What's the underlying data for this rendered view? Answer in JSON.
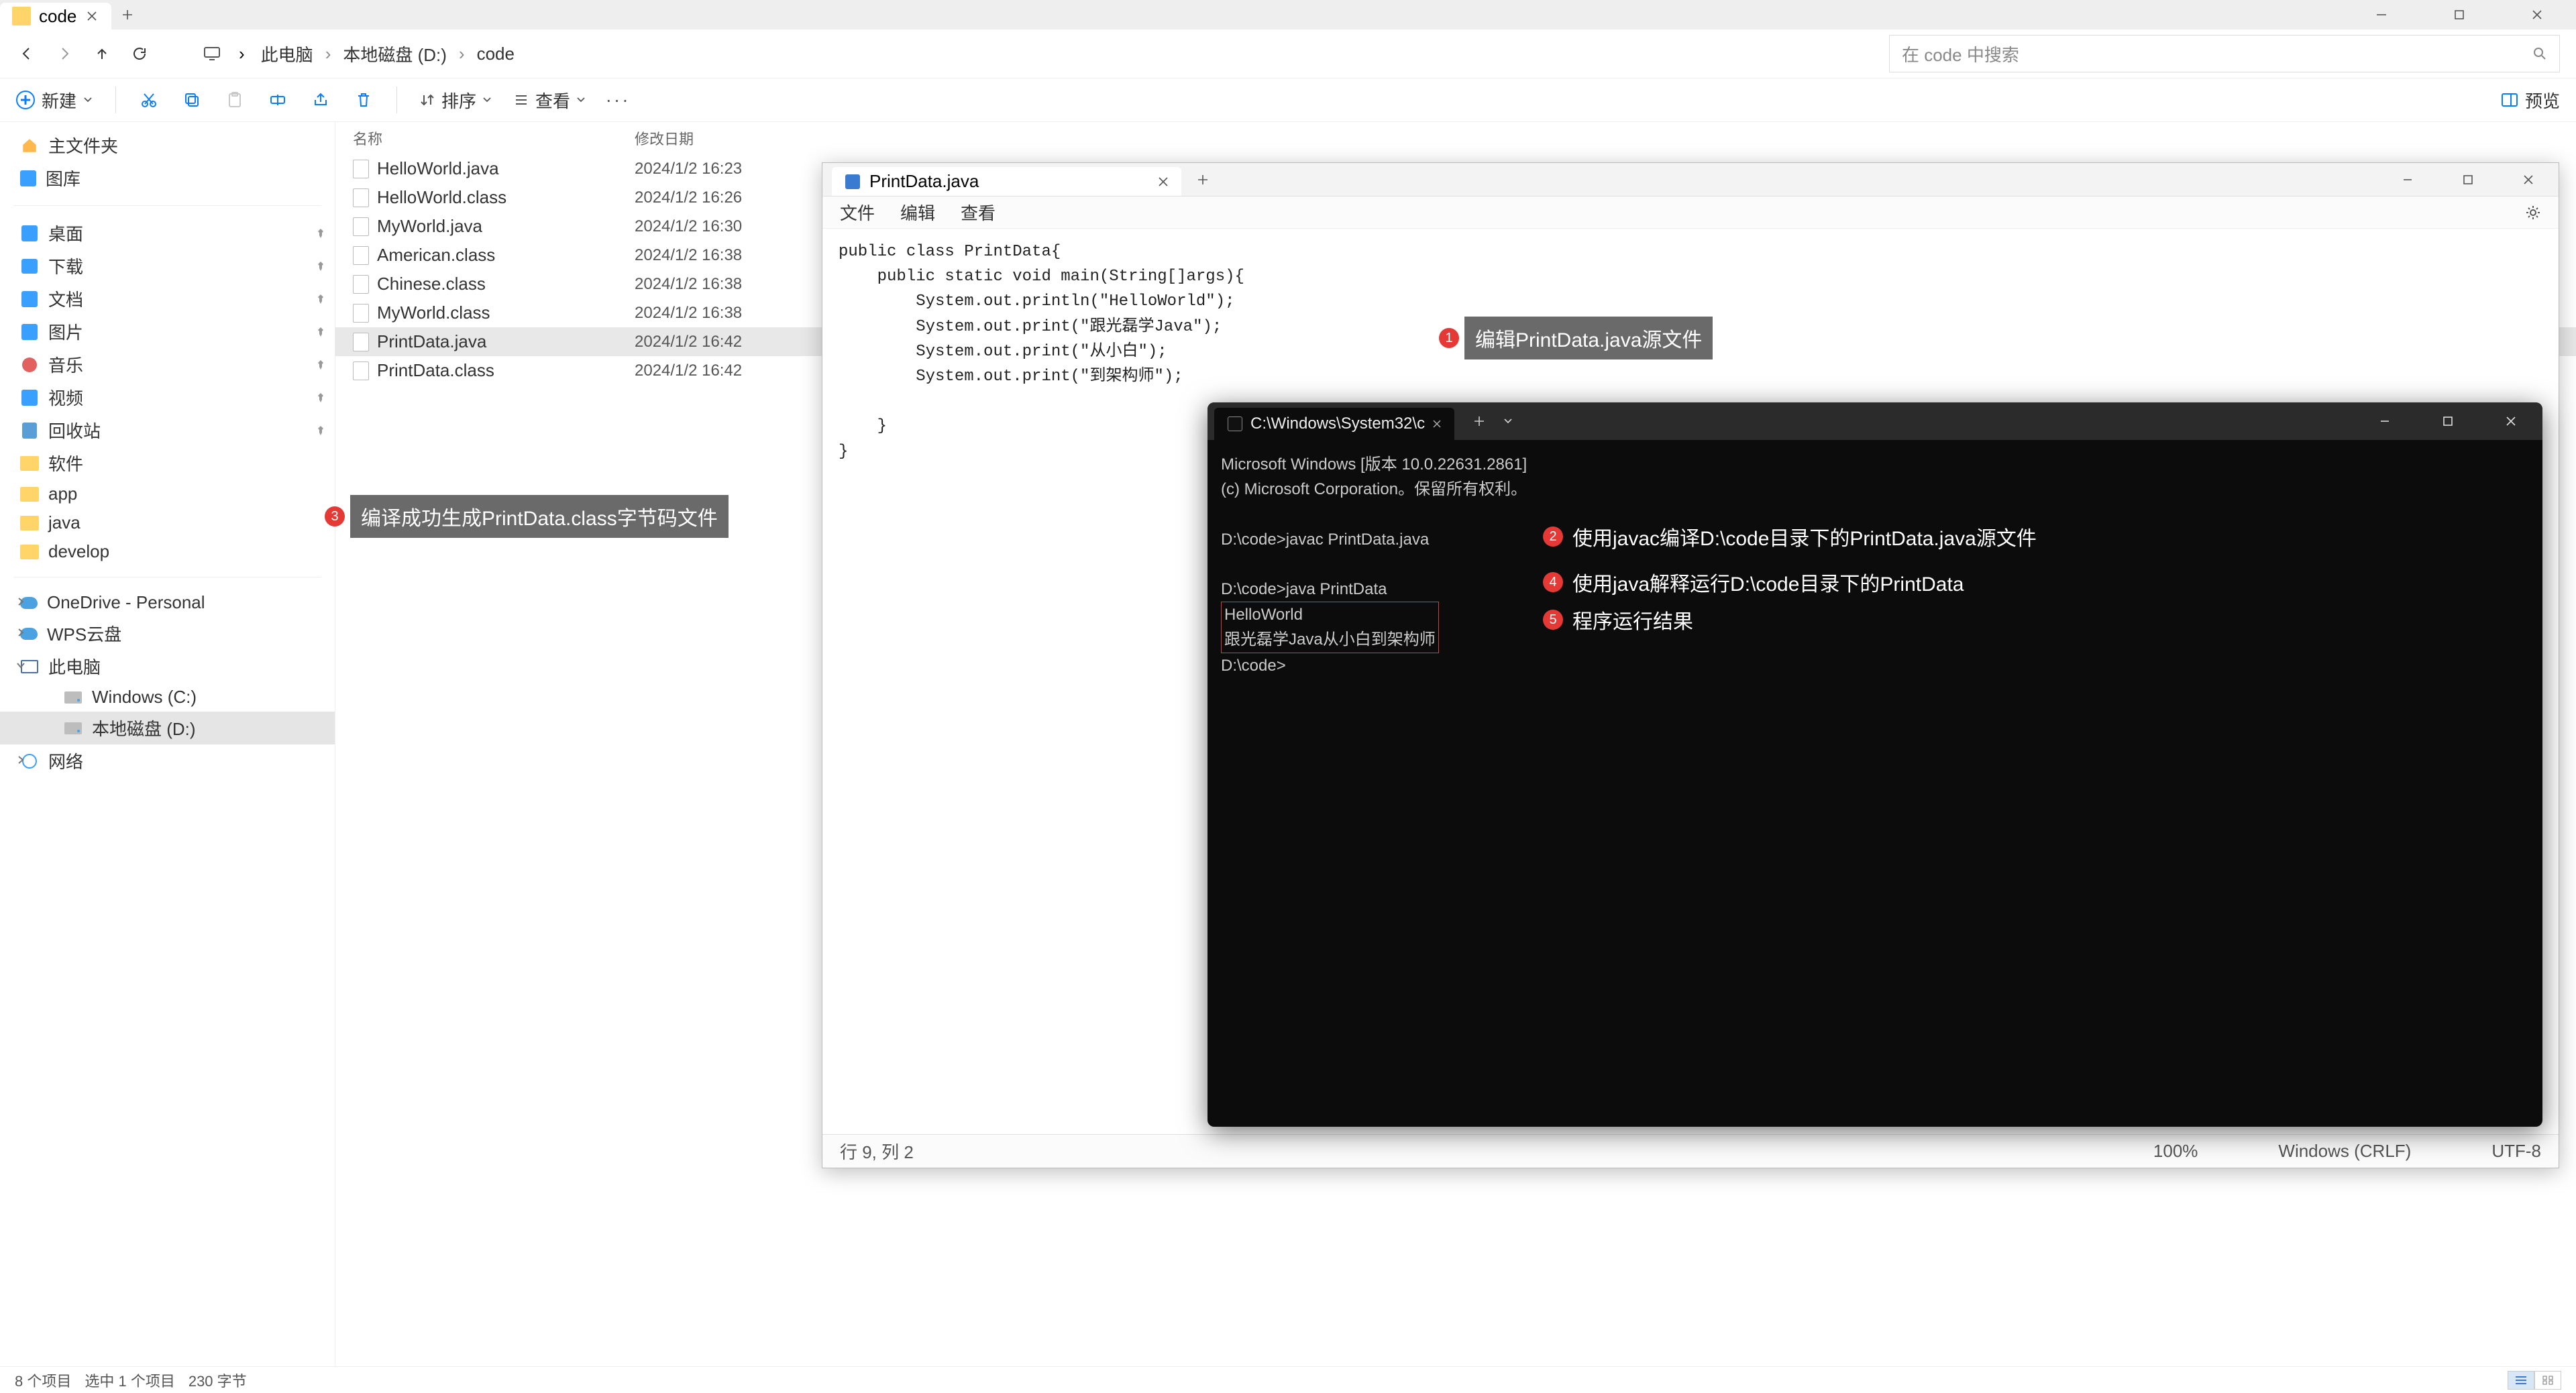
{
  "explorer": {
    "tab_title": "code",
    "search_placeholder": "在 code 中搜索",
    "breadcrumbs": [
      "此电脑",
      "本地磁盘 (D:)",
      "code"
    ],
    "toolbar": {
      "new": "新建",
      "sort": "排序",
      "view": "查看",
      "preview": "预览"
    },
    "sidebar": {
      "home": "主文件夹",
      "gallery": "图库",
      "quick": [
        {
          "label": "桌面",
          "kind": "blue"
        },
        {
          "label": "下载",
          "kind": "dl"
        },
        {
          "label": "文档",
          "kind": "blue"
        },
        {
          "label": "图片",
          "kind": "blue"
        },
        {
          "label": "音乐",
          "kind": "red"
        },
        {
          "label": "视频",
          "kind": "blue"
        },
        {
          "label": "回收站",
          "kind": "trash"
        },
        {
          "label": "软件",
          "kind": "folder"
        },
        {
          "label": "app",
          "kind": "folder"
        },
        {
          "label": "java",
          "kind": "folder"
        },
        {
          "label": "develop",
          "kind": "folder"
        }
      ],
      "onedrive": "OneDrive - Personal",
      "wps": "WPS云盘",
      "this_pc": "此电脑",
      "c_drive": "Windows (C:)",
      "d_drive": "本地磁盘 (D:)",
      "network": "网络"
    },
    "columns": {
      "name": "名称",
      "date": "修改日期"
    },
    "files": [
      {
        "name": "HelloWorld.java",
        "date": "2024/1/2 16:23"
      },
      {
        "name": "HelloWorld.class",
        "date": "2024/1/2 16:26"
      },
      {
        "name": "MyWorld.java",
        "date": "2024/1/2 16:30"
      },
      {
        "name": "American.class",
        "date": "2024/1/2 16:38"
      },
      {
        "name": "Chinese.class",
        "date": "2024/1/2 16:38"
      },
      {
        "name": "MyWorld.class",
        "date": "2024/1/2 16:38"
      },
      {
        "name": "PrintData.java",
        "date": "2024/1/2 16:42",
        "selected": true
      },
      {
        "name": "PrintData.class",
        "date": "2024/1/2 16:42"
      }
    ],
    "status": {
      "items": "8 个项目",
      "selected": "选中 1 个项目",
      "size": "230 字节"
    }
  },
  "notepad": {
    "tab": "PrintData.java",
    "menu": {
      "file": "文件",
      "edit": "编辑",
      "view": "查看"
    },
    "code": "public class PrintData{\n    public static void main(String[]args){\n        System.out.println(\"HelloWorld\");\n        System.out.print(\"跟光磊学Java\");\n        System.out.print(\"从小白\");\n        System.out.print(\"到架构师\");\n\n    }\n}",
    "status": {
      "pos": "行 9, 列 2",
      "zoom": "100%",
      "eol": "Windows (CRLF)",
      "enc": "UTF-8"
    }
  },
  "terminal": {
    "tab": "C:\\Windows\\System32\\c",
    "header1": "Microsoft Windows [版本 10.0.22631.2861]",
    "header2": "(c) Microsoft Corporation。保留所有权利。",
    "line1": "D:\\code>javac PrintData.java",
    "line2": "D:\\code>java PrintData",
    "out1": "HelloWorld",
    "out2": "跟光磊学Java从小白到架构师",
    "prompt": "D:\\code>"
  },
  "annotations": {
    "a1": "编辑PrintData.java源文件",
    "a2": "使用javac编译D:\\code目录下的PrintData.java源文件",
    "a3": "编译成功生成PrintData.class字节码文件",
    "a4": "使用java解释运行D:\\code目录下的PrintData",
    "a5": "程序运行结果"
  }
}
